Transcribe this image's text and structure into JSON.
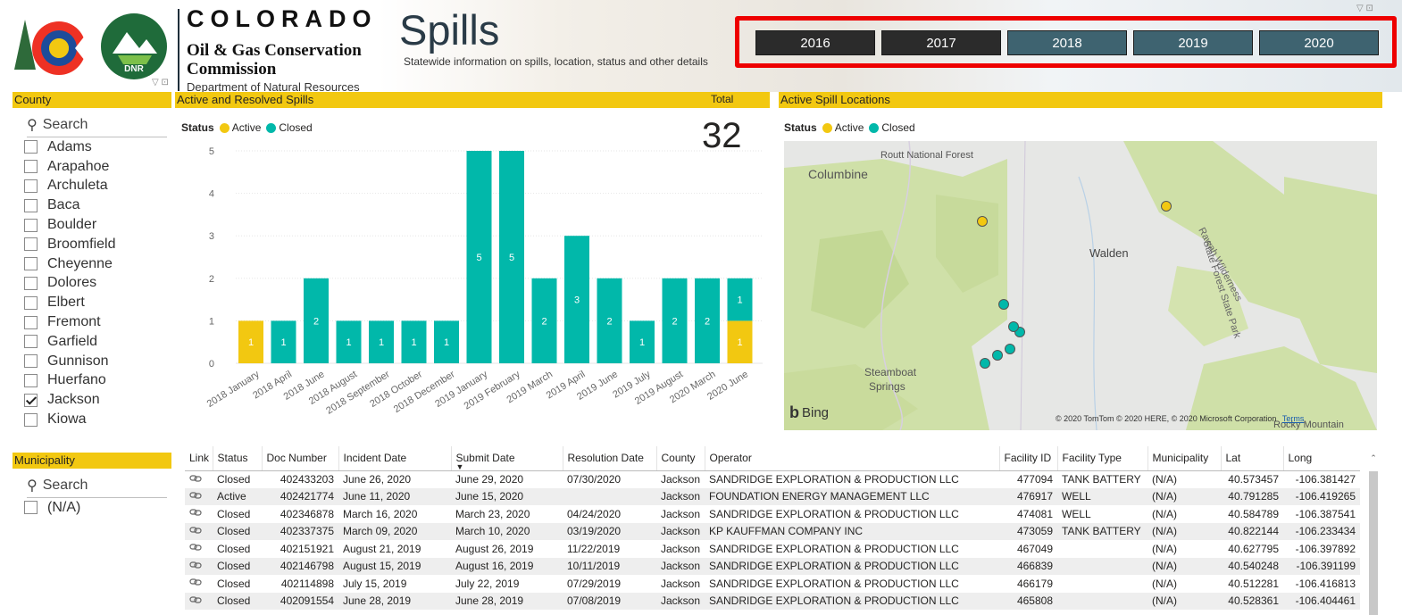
{
  "header": {
    "brand_colorado": "COLORADO",
    "brand_ogcc_1": "Oil & Gas Conservation",
    "brand_ogcc_2": "Commission",
    "brand_dnr": "Department of Natural Resources",
    "title": "Spills",
    "subtitle": "Statewide information on spills, location, status and other details"
  },
  "years": [
    {
      "label": "2016",
      "selected": true
    },
    {
      "label": "2017",
      "selected": true
    },
    {
      "label": "2018",
      "selected": false
    },
    {
      "label": "2019",
      "selected": false
    },
    {
      "label": "2020",
      "selected": false
    }
  ],
  "county_slicer": {
    "title": "County",
    "search_placeholder": "Search",
    "items": [
      {
        "label": "Adams",
        "checked": false
      },
      {
        "label": "Arapahoe",
        "checked": false
      },
      {
        "label": "Archuleta",
        "checked": false
      },
      {
        "label": "Baca",
        "checked": false
      },
      {
        "label": "Boulder",
        "checked": false
      },
      {
        "label": "Broomfield",
        "checked": false
      },
      {
        "label": "Cheyenne",
        "checked": false
      },
      {
        "label": "Dolores",
        "checked": false
      },
      {
        "label": "Elbert",
        "checked": false
      },
      {
        "label": "Fremont",
        "checked": false
      },
      {
        "label": "Garfield",
        "checked": false
      },
      {
        "label": "Gunnison",
        "checked": false
      },
      {
        "label": "Huerfano",
        "checked": false
      },
      {
        "label": "Jackson",
        "checked": true
      },
      {
        "label": "Kiowa",
        "checked": false
      }
    ]
  },
  "municipality_slicer": {
    "title": "Municipality",
    "search_placeholder": "Search",
    "items": [
      {
        "label": "(N/A)",
        "checked": false
      }
    ]
  },
  "spills_panel": {
    "title": "Active and Resolved Spills",
    "total_label": "Total",
    "total_value": "32",
    "legend_title": "Status",
    "legend": [
      {
        "label": "Active",
        "color": "#f2c811"
      },
      {
        "label": "Closed",
        "color": "#01b8aa"
      }
    ]
  },
  "chart_data": {
    "type": "bar",
    "stacked": true,
    "categories": [
      "2018 January",
      "2018 April",
      "2018 June",
      "2018 August",
      "2018 September",
      "2018 October",
      "2018 December",
      "2019 January",
      "2019 February",
      "2019 March",
      "2019 April",
      "2019 June",
      "2019 July",
      "2019 August",
      "2020 March",
      "2020 June"
    ],
    "series": [
      {
        "name": "Active",
        "color": "#f2c811",
        "values": [
          1,
          0,
          0,
          0,
          0,
          0,
          0,
          0,
          0,
          0,
          0,
          0,
          0,
          0,
          0,
          1
        ]
      },
      {
        "name": "Closed",
        "color": "#01b8aa",
        "values": [
          0,
          1,
          2,
          1,
          1,
          1,
          1,
          5,
          5,
          2,
          3,
          2,
          1,
          2,
          2,
          1
        ]
      }
    ],
    "ylim": [
      0,
      5
    ],
    "yticks": [
      0,
      1,
      2,
      3,
      4,
      5
    ],
    "grid": true,
    "legend_position": "top-left"
  },
  "map_panel": {
    "title": "Active Spill Locations",
    "legend_title": "Status",
    "legend": [
      {
        "label": "Active",
        "color": "#f2c811"
      },
      {
        "label": "Closed",
        "color": "#01b8aa"
      }
    ],
    "labels": {
      "columbine": "Columbine",
      "routt": "Routt National Forest",
      "walden": "Walden",
      "rawah": "Rawah Wilderness",
      "sfsp": "State Forest State Park",
      "steamboat_1": "Steamboat",
      "steamboat_2": "Springs",
      "rocky": "Rocky Mountain",
      "bing": "Bing",
      "copyright": "© 2020 TomTom © 2020 HERE, © 2020 Microsoft Corporation",
      "terms": "Terms"
    },
    "points": [
      {
        "status": "Active",
        "lat": 40.791285,
        "long": -106.419265
      },
      {
        "status": "Active",
        "lat": 40.822144,
        "long": -106.233434
      },
      {
        "status": "Closed",
        "lat": 40.573457,
        "long": -106.381427
      },
      {
        "status": "Closed",
        "lat": 40.584789,
        "long": -106.387541
      },
      {
        "status": "Closed",
        "lat": 40.627795,
        "long": -106.397892
      },
      {
        "status": "Closed",
        "lat": 40.540248,
        "long": -106.391199
      },
      {
        "status": "Closed",
        "lat": 40.512281,
        "long": -106.416813
      },
      {
        "status": "Closed",
        "lat": 40.528361,
        "long": -106.404461
      }
    ]
  },
  "table": {
    "columns": [
      "Link",
      "Status",
      "Doc Number",
      "Incident Date",
      "Submit Date",
      "Resolution Date",
      "County",
      "Operator",
      "Facility ID",
      "Facility Type",
      "Municipality",
      "Lat",
      "Long"
    ],
    "sorted_column": "Submit Date",
    "rows": [
      [
        "link",
        "Closed",
        "402433203",
        "June 26, 2020",
        "June 29, 2020",
        "07/30/2020",
        "Jackson",
        "SANDRIDGE EXPLORATION & PRODUCTION LLC",
        "477094",
        "TANK BATTERY",
        "(N/A)",
        "40.573457",
        "-106.381427"
      ],
      [
        "link",
        "Active",
        "402421774",
        "June 11, 2020",
        "June 15, 2020",
        "",
        "Jackson",
        "FOUNDATION ENERGY MANAGEMENT LLC",
        "476917",
        "WELL",
        "(N/A)",
        "40.791285",
        "-106.419265"
      ],
      [
        "link",
        "Closed",
        "402346878",
        "March 16, 2020",
        "March 23, 2020",
        "04/24/2020",
        "Jackson",
        "SANDRIDGE EXPLORATION & PRODUCTION LLC",
        "474081",
        "WELL",
        "(N/A)",
        "40.584789",
        "-106.387541"
      ],
      [
        "link",
        "Closed",
        "402337375",
        "March 09, 2020",
        "March 10, 2020",
        "03/19/2020",
        "Jackson",
        "KP KAUFFMAN COMPANY INC",
        "473059",
        "TANK BATTERY",
        "(N/A)",
        "40.822144",
        "-106.233434"
      ],
      [
        "link",
        "Closed",
        "402151921",
        "August 21, 2019",
        "August 26, 2019",
        "11/22/2019",
        "Jackson",
        "SANDRIDGE EXPLORATION & PRODUCTION LLC",
        "467049",
        "",
        "(N/A)",
        "40.627795",
        "-106.397892"
      ],
      [
        "link",
        "Closed",
        "402146798",
        "August 15, 2019",
        "August 16, 2019",
        "10/11/2019",
        "Jackson",
        "SANDRIDGE EXPLORATION & PRODUCTION LLC",
        "466839",
        "",
        "(N/A)",
        "40.540248",
        "-106.391199"
      ],
      [
        "link",
        "Closed",
        "402114898",
        "July 15, 2019",
        "July 22, 2019",
        "07/29/2019",
        "Jackson",
        "SANDRIDGE EXPLORATION & PRODUCTION LLC",
        "466179",
        "",
        "(N/A)",
        "40.512281",
        "-106.416813"
      ],
      [
        "link",
        "Closed",
        "402091554",
        "June 28, 2019",
        "June 28, 2019",
        "07/08/2019",
        "Jackson",
        "SANDRIDGE EXPLORATION & PRODUCTION LLC",
        "465808",
        "",
        "(N/A)",
        "40.528361",
        "-106.404461"
      ]
    ]
  }
}
